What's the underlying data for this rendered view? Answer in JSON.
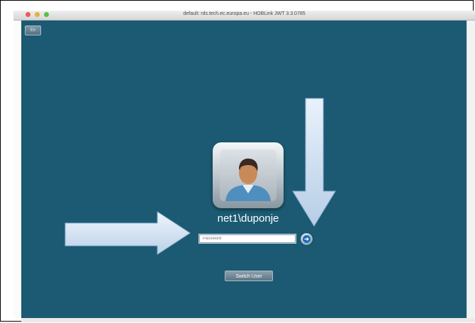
{
  "window": {
    "title": "default: rds.tech.ec.europa.eu - HOBLink JWT 3.3.0785"
  },
  "desktop": {
    "language_button": "En",
    "username": "net1\\duponje",
    "password_placeholder": "Password",
    "switch_user_label": "Switch User",
    "background_color": "#1b5a72"
  },
  "icons": {
    "avatar": "user-avatar-icon",
    "go": "arrow-right-icon",
    "annotation_arrows": [
      "arrow-down-annotation",
      "arrow-right-annotation"
    ]
  }
}
